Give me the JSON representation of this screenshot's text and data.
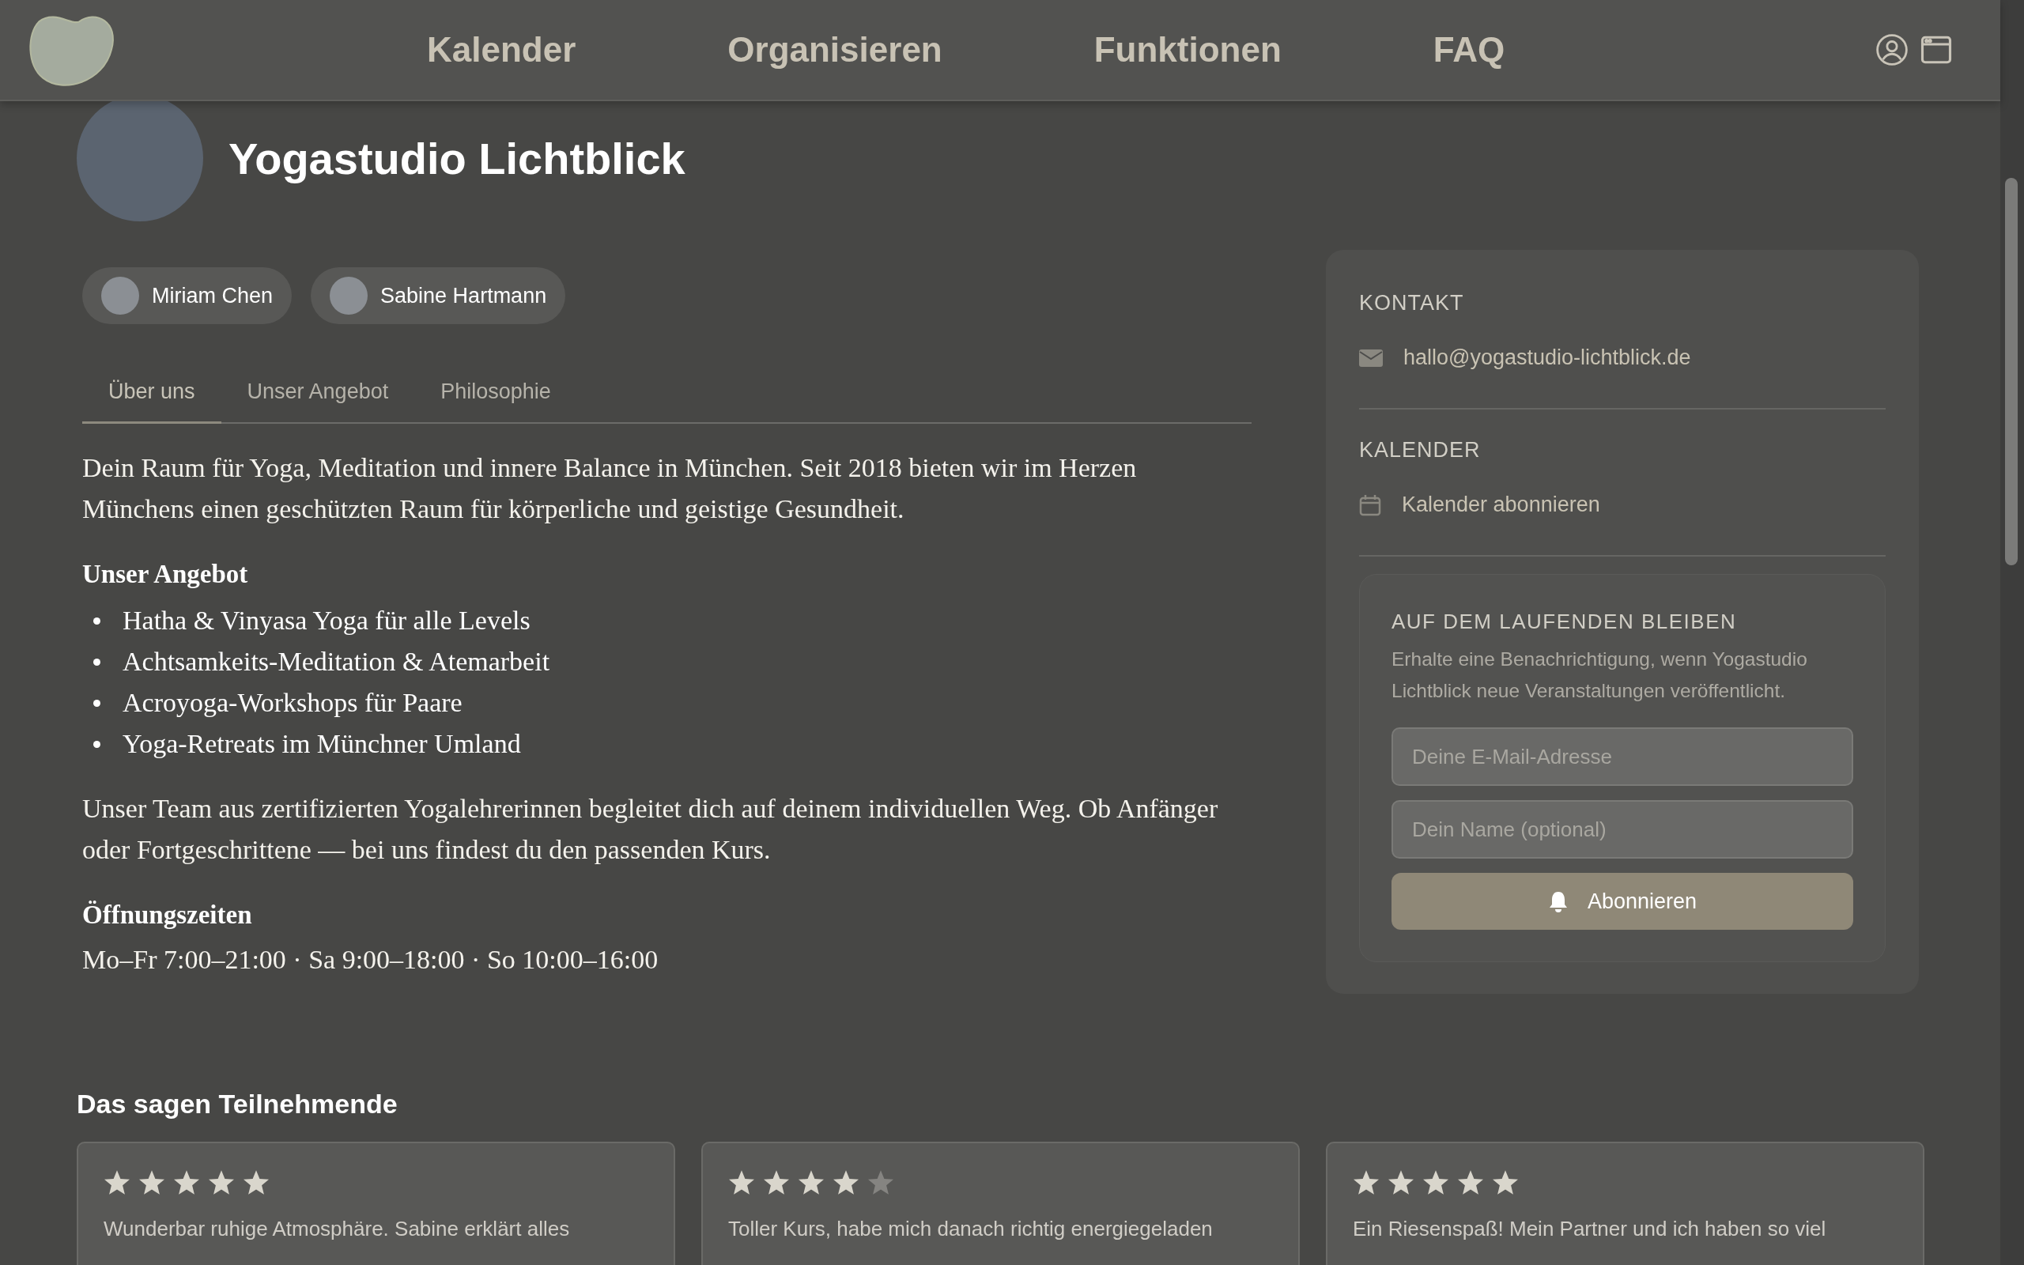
{
  "nav": {
    "links": [
      "Kalender",
      "Organisieren",
      "Funktionen",
      "FAQ"
    ]
  },
  "studio": {
    "name": "Yogastudio Lichtblick"
  },
  "teachers": [
    {
      "name": "Miriam Chen"
    },
    {
      "name": "Sabine Hartmann"
    }
  ],
  "tabs": [
    {
      "label": "Über uns",
      "selected": true
    },
    {
      "label": "Unser Angebot",
      "selected": false
    },
    {
      "label": "Philosophie",
      "selected": false
    }
  ],
  "about": {
    "intro": "Dein Raum für Yoga, Meditation und innere Balance in München. Seit 2018 bieten wir im Herzen Münchens einen geschützten Raum für körperliche und geistige Gesundheit.",
    "offer_heading": "Unser Angebot",
    "offer_items": [
      "Hatha & Vinyasa Yoga für alle Levels",
      "Achtsamkeits-Meditation & Atemarbeit",
      "Acroyoga-Workshops für Paare",
      "Yoga-Retreats im Münchner Umland"
    ],
    "team": "Unser Team aus zertifizierten Yogalehrerinnen begleitet dich auf deinem individuellen Weg. Ob Anfänger oder Fortgeschrittene — bei uns findest du den passenden Kurs.",
    "hours_heading": "Öffnungszeiten",
    "hours": "Mo–Fr 7:00–21:00 · Sa 9:00–18:00 · So 10:00–16:00"
  },
  "sidebar": {
    "contact_heading": "KONTAKT",
    "email": "hallo@yogastudio-lichtblick.de",
    "calendar_heading": "KALENDER",
    "calendar_link": "Kalender abonnieren",
    "subscribe": {
      "heading": "AUF DEM LAUFENDEN BLEIBEN",
      "text": "Erhalte eine Benachrichtigung, wenn Yogastudio Lichtblick neue Veranstaltungen veröffentlicht.",
      "email_placeholder": "Deine E-Mail-Adresse",
      "name_placeholder": "Dein Name (optional)",
      "button": "Abonnieren"
    }
  },
  "reviews": {
    "heading": "Das sagen Teilnehmende",
    "items": [
      {
        "stars": 5,
        "text": "Wunderbar ruhige Atmosphäre. Sabine erklärt alles"
      },
      {
        "stars": 4,
        "text": "Toller Kurs, habe mich danach richtig energiegeladen"
      },
      {
        "stars": 5,
        "text": "Ein Riesenspaß! Mein Partner und ich haben so viel"
      }
    ]
  }
}
